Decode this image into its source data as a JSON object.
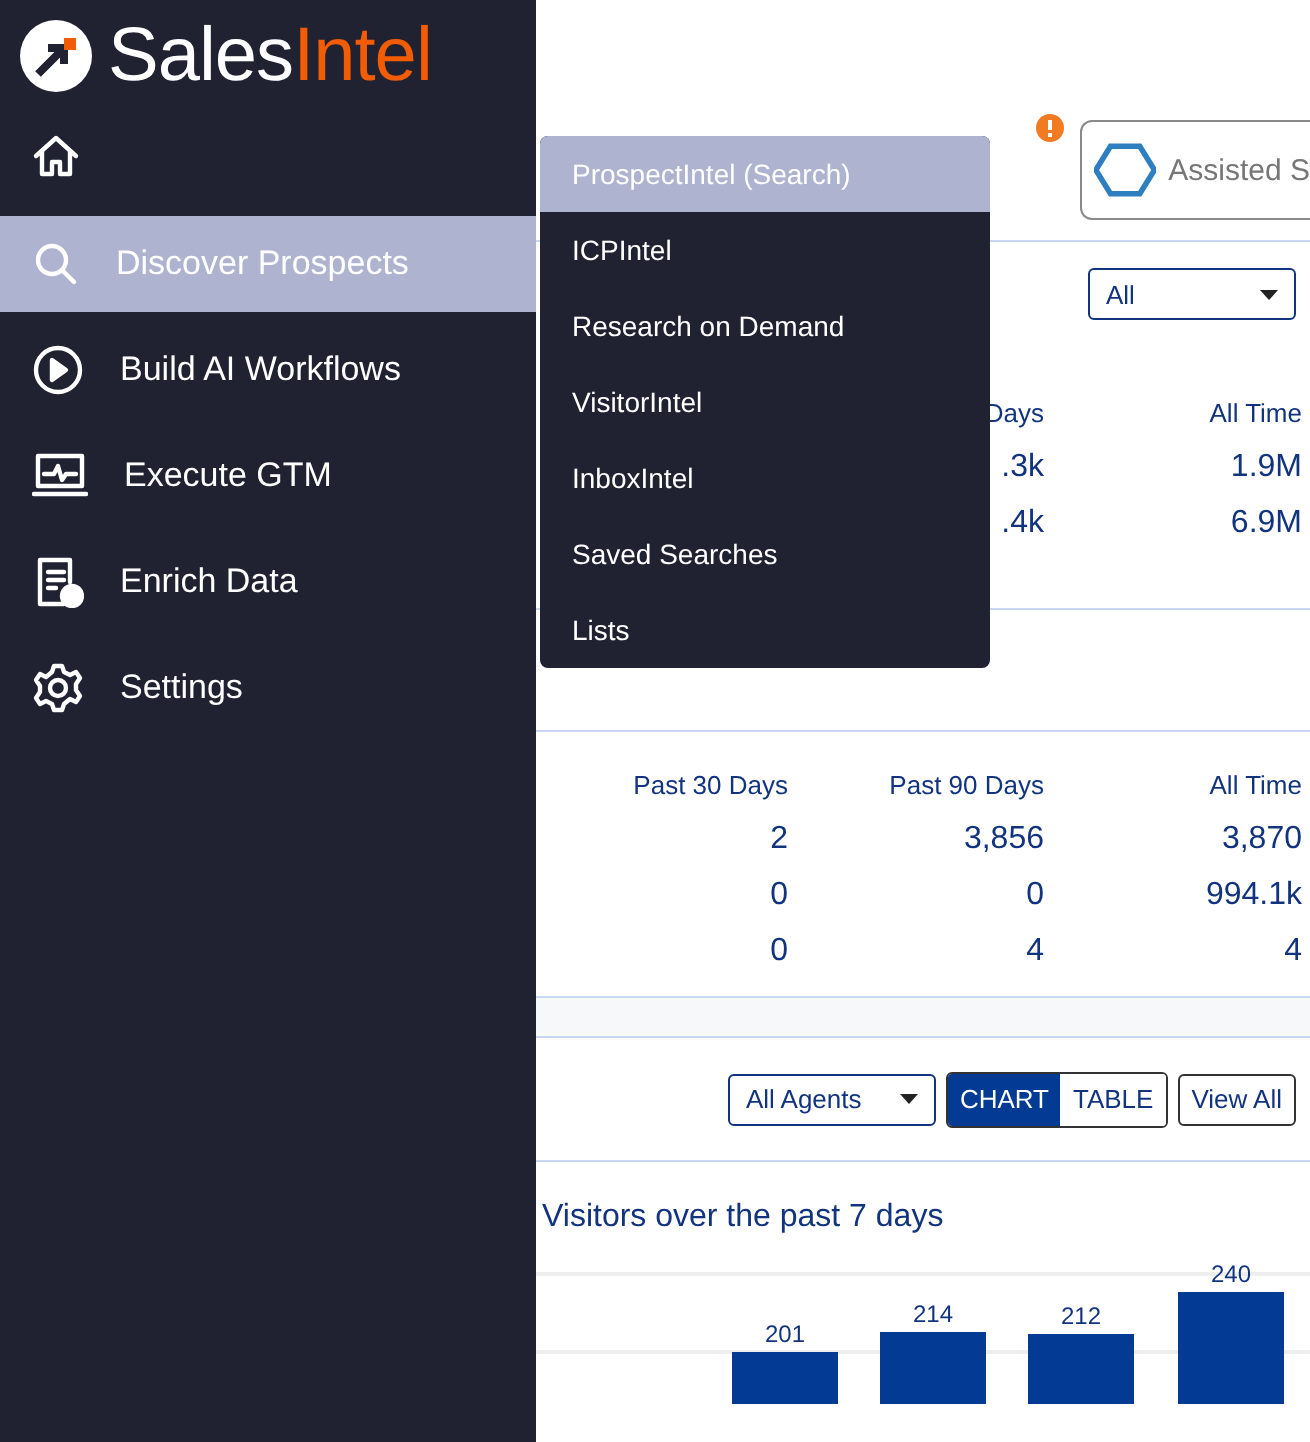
{
  "logo": {
    "primary": "Sales",
    "accent": "Intel"
  },
  "sidebar": {
    "items": [
      {
        "label": "Discover Prospects",
        "selected": true
      },
      {
        "label": "Build AI Workflows",
        "selected": false
      },
      {
        "label": "Execute GTM",
        "selected": false
      },
      {
        "label": "Enrich Data",
        "selected": false
      },
      {
        "label": "Settings",
        "selected": false
      }
    ]
  },
  "submenu": {
    "items": [
      {
        "label": "ProspectIntel (Search)",
        "selected": true
      },
      {
        "label": "ICPIntel",
        "selected": false
      },
      {
        "label": "Research on Demand",
        "selected": false
      },
      {
        "label": "VisitorIntel",
        "selected": false
      },
      {
        "label": "InboxIntel",
        "selected": false
      },
      {
        "label": "Saved Searches",
        "selected": false
      },
      {
        "label": "Lists",
        "selected": false
      }
    ]
  },
  "header": {
    "assisted_button": "Assisted S"
  },
  "panel_1": {
    "filter": "All",
    "columns": [
      "Days",
      "All Time"
    ],
    "rows": [
      [
        ".3k",
        "1.9M"
      ],
      [
        ".4k",
        "6.9M"
      ]
    ]
  },
  "panel_2": {
    "columns": [
      "Past 30 Days",
      "Past 90 Days",
      "All Time"
    ],
    "rows": [
      [
        "2",
        "3,856",
        "3,870"
      ],
      [
        "0",
        "0",
        "994.1k"
      ],
      [
        "0",
        "4",
        "4"
      ]
    ]
  },
  "panel_3": {
    "agent_filter": "All Agents",
    "view_toggle": [
      {
        "label": "CHART",
        "selected": true
      },
      {
        "label": "TABLE",
        "selected": false
      }
    ],
    "view_all": "View All",
    "title": "Visitors over the past 7 days",
    "bar_labels": [
      "201",
      "214",
      "212",
      "240"
    ]
  }
}
